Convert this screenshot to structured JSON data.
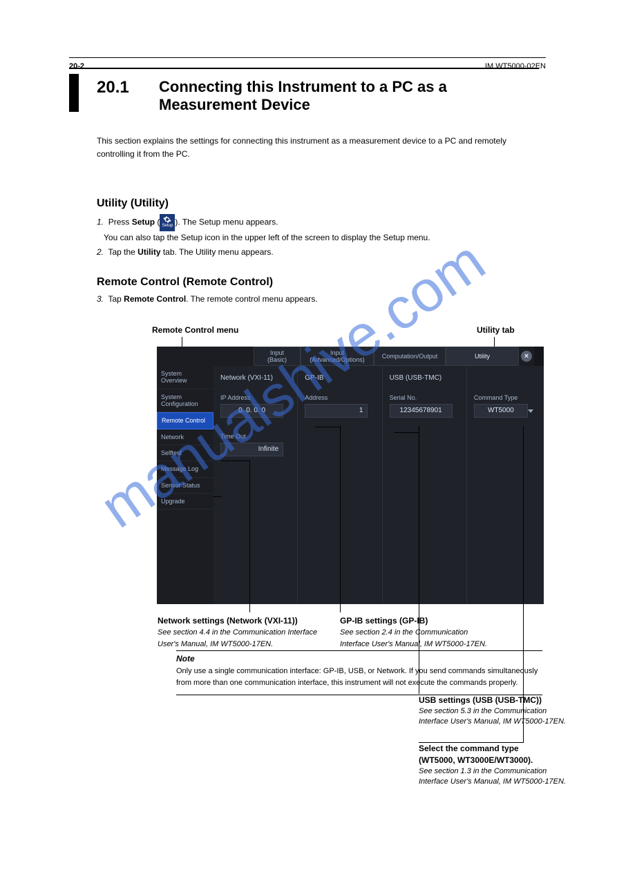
{
  "section": {
    "number": "20.1",
    "title_line1": "Connecting this Instrument to a PC as a",
    "title_line2": "Measurement Device"
  },
  "intro": "This section explains the settings for connecting this instrument as a measurement device to a PC and remotely controlling it from the PC.",
  "heading1": "Utility (Utility)",
  "step1_prefix": "1.",
  "step1_body_a": "Press ",
  "step1_body_b": "Setup",
  "step1_body_c": " (",
  "step1_body_d": "). The Setup menu appears.",
  "step1_body_e": "You can also tap the Setup icon in the upper left of the screen to display the Setup menu.",
  "step2_prefix": "2.",
  "step2_body_a": "Tap the ",
  "step2_body_b": "Utility",
  "step2_body_c": " tab. The Utility menu appears.",
  "heading2": "Remote Control (Remote Control)",
  "step3_prefix": "3.",
  "step3_body_a": "Tap ",
  "step3_body_b": "Remote Control",
  "step3_body_c": ". The remote control menu appears.",
  "label_top_left": "Remote Control menu",
  "label_top_right": "Utility tab",
  "setup_icon_caption": "Setup",
  "screenshot": {
    "tabs": {
      "input_basic_a": "Input",
      "input_basic_b": "(Basic)",
      "input_adv_a": "Input",
      "input_adv_b": "(Advanced/Options)",
      "comp_out": "Computation/Output",
      "utility": "Utility"
    },
    "close_glyph": "×",
    "sidebar": {
      "overview_a": "System",
      "overview_b": "Overview",
      "config_a": "System",
      "config_b": "Configuration",
      "remote": "Remote Control",
      "network": "Network",
      "selftest": "Selftest",
      "msglog": "Message Log",
      "sensor": "Sensor Status",
      "upgrade": "Upgrade"
    },
    "cols": {
      "net_title": "Network (VXI-11)",
      "gpib_title": "GP-IB",
      "usb_title": "USB (USB-TMC)",
      "ip_label": "IP Address",
      "ip_value": "0.   0.   0.   0",
      "timeout_label": "Time Out",
      "timeout_value": "Infinite",
      "addr_label": "Address",
      "addr_value": "1",
      "serial_label": "Serial No.",
      "serial_value": "12345678901",
      "cmd_label": "Command Type",
      "cmd_value": "WT5000"
    }
  },
  "callouts": {
    "c1_bold": "Network settings (Network (VXI-11))",
    "c1_sub": "See section 4.4 in the Communication Interface",
    "c1_sub2": "User's Manual, IM WT5000-17EN.",
    "c2_bold": "GP-IB settings (GP-IB)",
    "c2_sub": "See section 2.4 in the Communication",
    "c2_sub2": "Interface User's Manual, IM WT5000-17EN.",
    "c3_bold": "USB settings (USB (USB-TMC))",
    "c3_sub": "See section 5.3 in the Communication",
    "c3_sub2": "Interface User's Manual, IM WT5000-17EN.",
    "c4_bold": "Select the command type",
    "c4_sub": "(WT5000, WT3000E/WT3000).",
    "c4_sub2": "See section 1.3 in the Communication",
    "c4_sub3": "Interface User's Manual, IM WT5000-17EN."
  },
  "note": {
    "title": "Note",
    "body": "Only use a single communication interface: GP-IB, USB, or Network. If you send commands simultaneously from more than one communication interface, this instrument will not execute the commands properly."
  },
  "footer": {
    "page": "20-2",
    "doc": "IM WT5000-02EN"
  }
}
